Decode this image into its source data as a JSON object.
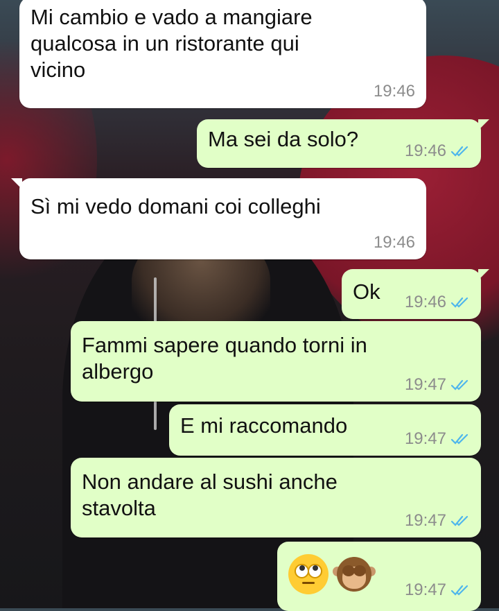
{
  "theme": {
    "incoming_bubble": "#ffffff",
    "outgoing_bubble": "#e1ffc7",
    "timestamp_color": "#8c8c8c",
    "read_tick_color": "#4fb6ec"
  },
  "messages": [
    {
      "direction": "incoming",
      "text": "Mi cambio e vado a mangiare\nqualcosa in un ristorante qui\nvicino",
      "time": "19:46",
      "tail": false
    },
    {
      "direction": "outgoing",
      "text": "Ma sei da solo?",
      "time": "19:46",
      "status": "read",
      "tail": true
    },
    {
      "direction": "incoming",
      "text": "Sì mi vedo domani coi colleghi",
      "time": "19:46",
      "tail": true
    },
    {
      "direction": "outgoing",
      "text": "Ok",
      "time": "19:46",
      "status": "read",
      "tail": true
    },
    {
      "direction": "outgoing",
      "text": "Fammi sapere quando torni in\nalbergo",
      "time": "19:47",
      "status": "read",
      "tail": false
    },
    {
      "direction": "outgoing",
      "text": "E mi raccomando",
      "time": "19:47",
      "status": "read",
      "tail": false
    },
    {
      "direction": "outgoing",
      "text": "Non andare al sushi anche\nstavolta",
      "time": "19:47",
      "status": "read",
      "tail": false
    },
    {
      "direction": "outgoing",
      "emojis": [
        "face-with-rolling-eyes",
        "see-no-evil-monkey"
      ],
      "time": "19:47",
      "status": "read",
      "tail": false
    }
  ]
}
